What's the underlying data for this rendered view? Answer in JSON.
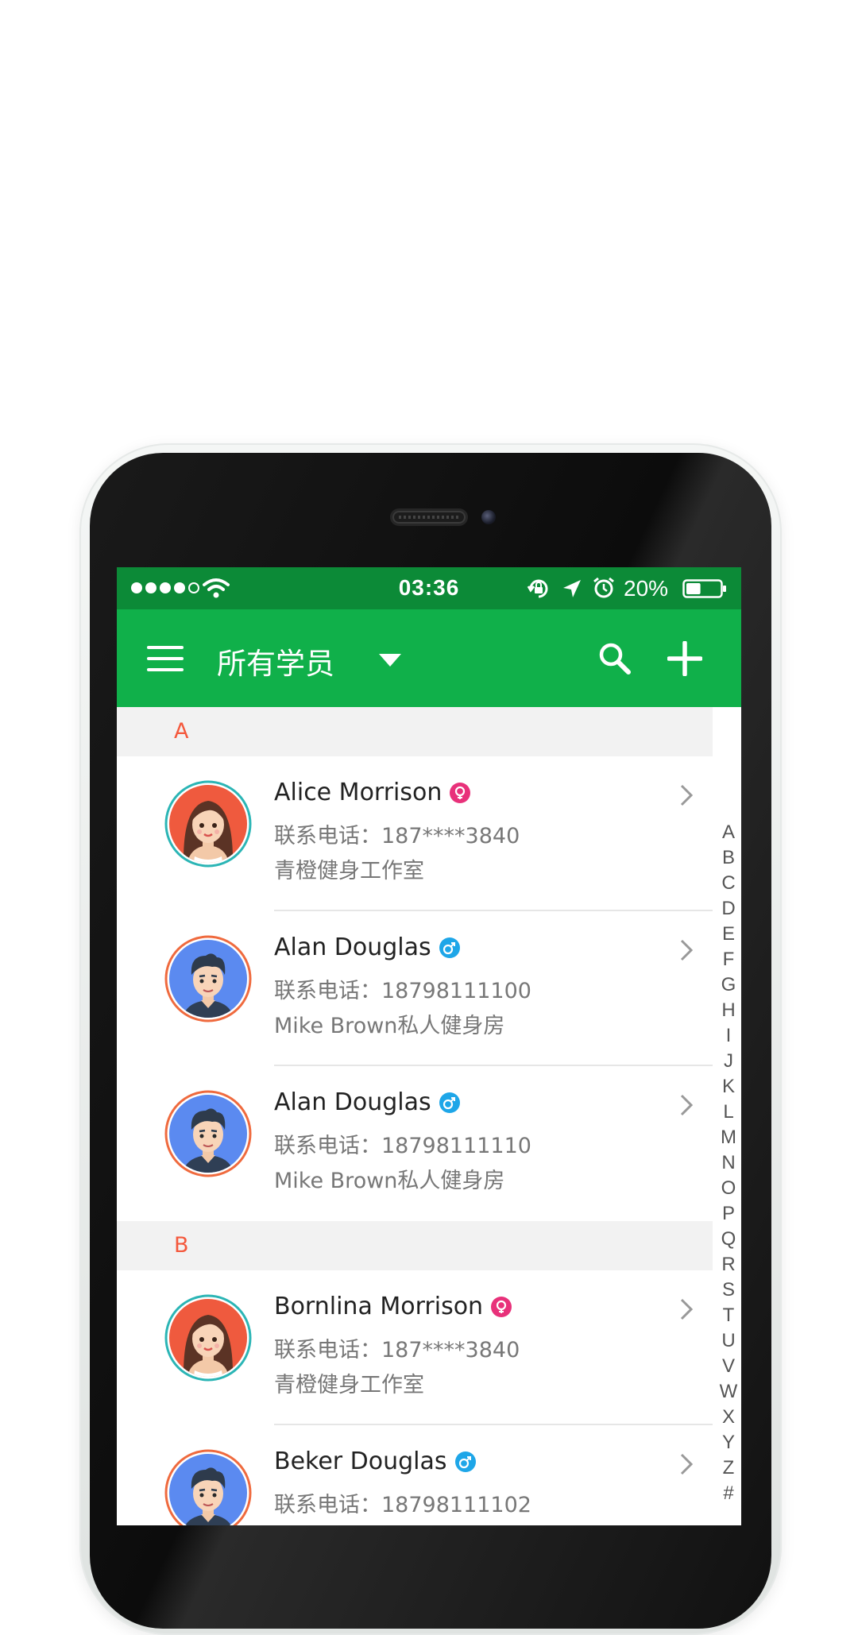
{
  "status_bar": {
    "time": "03:36",
    "battery_percent": "20%",
    "battery_level": 0.2,
    "signal_bars": 4,
    "icons": [
      "signal-dots",
      "wifi-icon",
      "rotation-lock-icon",
      "location-arrow-icon",
      "alarm-clock-icon",
      "battery-icon"
    ]
  },
  "app_bar": {
    "title": "所有学员",
    "icons": [
      "menu-icon",
      "dropdown-icon",
      "search-icon",
      "add-icon"
    ]
  },
  "colors": {
    "status_bar": "#0c8a37",
    "app_bar": "#10b04a",
    "section_letter": "#f4583c",
    "female_badge": "#e8317a",
    "male_badge": "#1ea6e8"
  },
  "sections": [
    {
      "letter": "A",
      "contacts": [
        {
          "name": "Alice Morrison",
          "gender": "female",
          "phone": "联系电话：187****3840",
          "gym": "青橙健身工作室"
        },
        {
          "name": "Alan Douglas",
          "gender": "male",
          "phone": "联系电话：18798111100",
          "gym": "Mike Brown私人健身房"
        },
        {
          "name": "Alan Douglas",
          "gender": "male",
          "phone": "联系电话：18798111110",
          "gym": "Mike Brown私人健身房"
        }
      ]
    },
    {
      "letter": "B",
      "contacts": [
        {
          "name": "Bornlina Morrison",
          "gender": "female",
          "phone": "联系电话：187****3840",
          "gym": "青橙健身工作室"
        },
        {
          "name": "Beker Douglas",
          "gender": "male",
          "phone": "联系电话：18798111102",
          "gym": ""
        }
      ]
    }
  ],
  "index_letters": [
    "A",
    "B",
    "C",
    "D",
    "E",
    "F",
    "G",
    "H",
    "I",
    "J",
    "K",
    "L",
    "M",
    "N",
    "O",
    "P",
    "Q",
    "R",
    "S",
    "T",
    "U",
    "V",
    "W",
    "X",
    "Y",
    "Z",
    "#"
  ]
}
